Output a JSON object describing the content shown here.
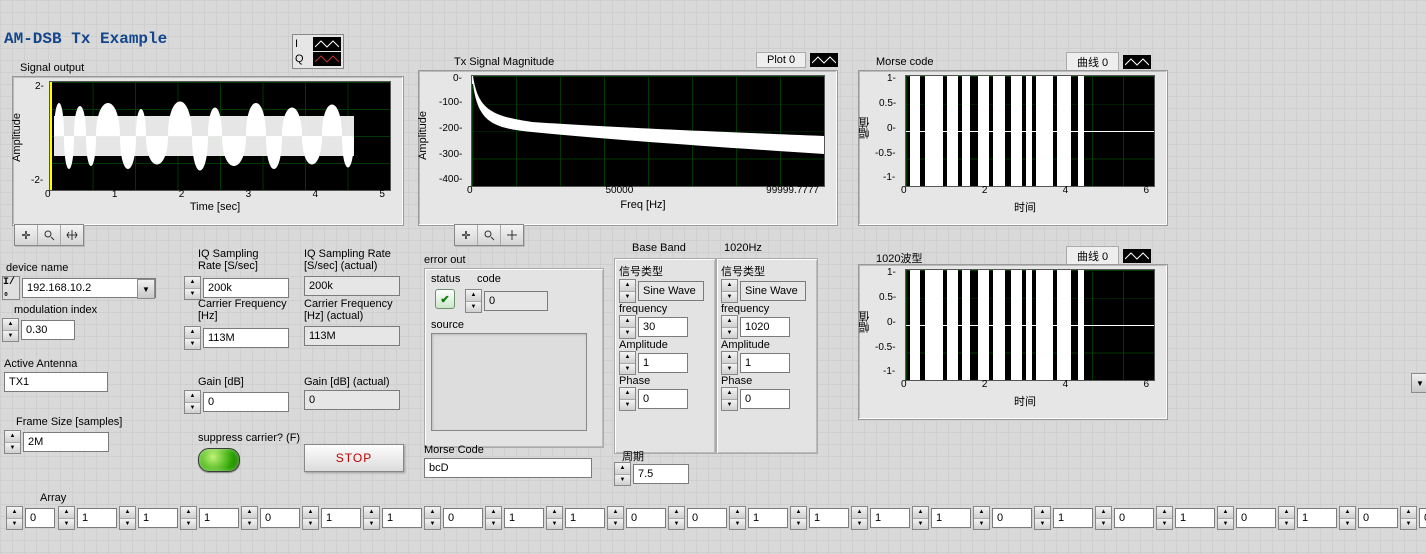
{
  "title": "AM-DSB  Tx Example",
  "chart_data": [
    {
      "id": "signal_output",
      "type": "line",
      "title": "Signal output",
      "xlabel": "Time [sec]",
      "ylabel": "Amplitude",
      "x_ticks": [
        0,
        1,
        2,
        3,
        4,
        5
      ],
      "y_ticks": [
        -2,
        2
      ],
      "series": [
        {
          "name": "I",
          "color": "#ffffff"
        },
        {
          "name": "Q",
          "color": "#ff4040"
        }
      ],
      "description": "densely modulated AM-DSB waveform filling roughly ±1.8 with bursts across 0–4.5 sec"
    },
    {
      "id": "tx_magnitude",
      "type": "line",
      "title": "Tx Signal Magnitude",
      "xlabel": "Freq [Hz]",
      "ylabel": "Amplitude",
      "x_ticks": [
        0,
        50000,
        99999.7777
      ],
      "y_ticks": [
        -400,
        -300,
        -200,
        -100,
        0
      ],
      "legend": "Plot 0",
      "description": "magnitude (dB) curve: near 0 at DC, steep drop to about -150 by ~2kHz, gentle slope to ~-220 near 100 kHz with broadening noise band"
    },
    {
      "id": "morse_code",
      "type": "line",
      "title": "Morse code",
      "xlabel": "时间",
      "ylabel": "幅值",
      "x_ticks": [
        0,
        2,
        4,
        6
      ],
      "y_ticks": [
        -1,
        -0.5,
        0,
        0.5,
        1
      ],
      "legend": "曲线 0",
      "pulses_on": [
        [
          0.1,
          0.35
        ],
        [
          0.45,
          0.9
        ],
        [
          1.0,
          1.25
        ],
        [
          1.35,
          1.55
        ],
        [
          1.75,
          2.0
        ],
        [
          2.1,
          2.4
        ],
        [
          2.55,
          2.8
        ],
        [
          2.9,
          3.05
        ],
        [
          3.15,
          3.55
        ],
        [
          3.65,
          4.0
        ],
        [
          4.15,
          4.3
        ]
      ],
      "amplitude": 1
    },
    {
      "id": "wave_1020",
      "type": "line",
      "title": "1020波型",
      "xlabel": "时间",
      "ylabel": "幅值",
      "x_ticks": [
        0,
        2,
        4,
        6
      ],
      "y_ticks": [
        -1,
        -0.5,
        0,
        0.5,
        1
      ],
      "legend": "曲线 0",
      "pulses_on": [
        [
          0.1,
          0.35
        ],
        [
          0.45,
          0.9
        ],
        [
          1.0,
          1.25
        ],
        [
          1.35,
          1.55
        ],
        [
          1.75,
          2.0
        ],
        [
          2.1,
          2.4
        ],
        [
          2.55,
          2.8
        ],
        [
          2.9,
          3.05
        ],
        [
          3.15,
          3.55
        ],
        [
          3.65,
          4.0
        ],
        [
          4.15,
          4.3
        ]
      ],
      "amplitude": 1
    }
  ],
  "legend_iq": {
    "i": "I",
    "q": "Q"
  },
  "controls": {
    "device_name": {
      "label": "device name",
      "value": "192.168.10.2"
    },
    "modulation_index": {
      "label": "modulation index",
      "value": "0.30"
    },
    "active_antenna": {
      "label": "Active Antenna",
      "value": "TX1"
    },
    "frame_size": {
      "label": "Frame Size [samples]",
      "value": "2M"
    },
    "iq_rate": {
      "label": "IQ Sampling Rate [S/sec]",
      "value": "200k"
    },
    "iq_rate_actual": {
      "label": "IQ Sampling Rate [S/sec] (actual)",
      "value": "200k"
    },
    "carrier": {
      "label": "Carrier Frequency [Hz]",
      "value": "113M"
    },
    "carrier_actual": {
      "label": "Carrier Frequency [Hz] (actual)",
      "value": "113M"
    },
    "gain": {
      "label": "Gain [dB]",
      "value": "0"
    },
    "gain_actual": {
      "label": "Gain [dB] (actual)",
      "value": "0"
    },
    "suppress_carrier": {
      "label": "suppress carrier? (F)",
      "value": false
    },
    "stop": "STOP",
    "morse_code": {
      "label": "Morse Code",
      "value": "bcD"
    }
  },
  "error_out": {
    "title": "error out",
    "status_label": "status",
    "code_label": "code",
    "code_value": "0",
    "source_label": "source",
    "source_value": ""
  },
  "baseband": {
    "title": "Base Band",
    "signal_type_label": "信号类型",
    "signal_type": "Sine Wave",
    "frequency_label": "frequency",
    "frequency": "30",
    "amplitude_label": "Amplitude",
    "amplitude": "1",
    "phase_label": "Phase",
    "phase": "0"
  },
  "hz1020": {
    "title": "1020Hz",
    "signal_type_label": "信号类型",
    "signal_type": "Sine Wave",
    "frequency_label": "frequency",
    "frequency": "1020",
    "amplitude_label": "Amplitude",
    "amplitude": "1",
    "phase_label": "Phase",
    "phase": "0"
  },
  "period": {
    "label": "周期",
    "value": "7.5"
  },
  "array": {
    "label": "Array",
    "index": "0",
    "values": [
      "1",
      "1",
      "1",
      "0",
      "1",
      "1",
      "0",
      "1",
      "1",
      "0",
      "0",
      "1",
      "1",
      "1",
      "1",
      "0",
      "1",
      "0",
      "1",
      "0",
      "1",
      "0",
      "0"
    ]
  }
}
